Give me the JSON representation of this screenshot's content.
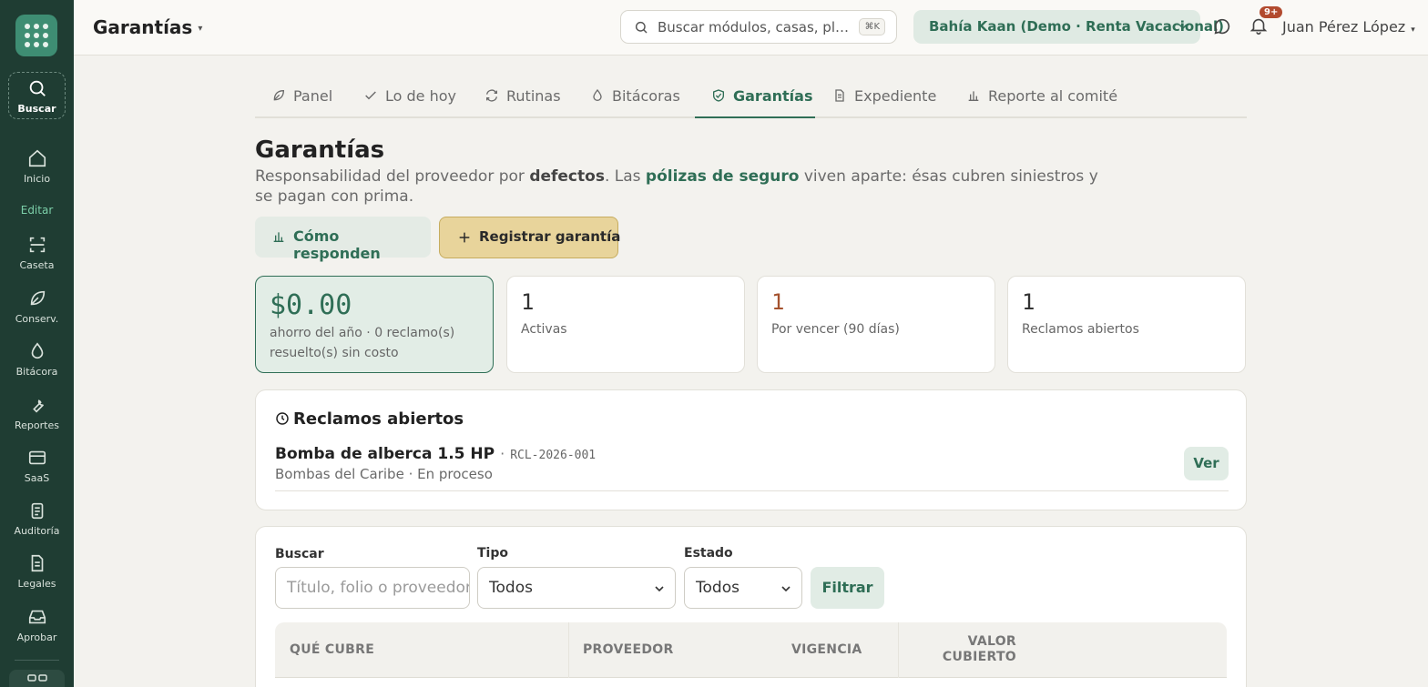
{
  "sidebar": {
    "items": [
      {
        "label": "Buscar",
        "icon": "search-icon"
      },
      {
        "label": "Inicio",
        "icon": "home-icon"
      },
      {
        "label": "Caseta",
        "icon": "scan-icon"
      },
      {
        "label": "Conserv.",
        "icon": "leaf-icon"
      },
      {
        "label": "Bitácora",
        "icon": "drop-icon"
      },
      {
        "label": "Reportes",
        "icon": "wrench-icon"
      },
      {
        "label": "SaaS",
        "icon": "card-icon"
      },
      {
        "label": "Auditoría",
        "icon": "clipboard-icon"
      },
      {
        "label": "Legales",
        "icon": "document-icon"
      },
      {
        "label": "Aprobar",
        "icon": "inbox-icon"
      }
    ],
    "section_label": "Editar"
  },
  "topbar": {
    "title": "Garantías",
    "search_placeholder": "Buscar módulos, casas, placas…",
    "search_shortcut": "⌘K",
    "org": "Bahía Kaan (Demo · Renta Vacacional)",
    "notifications_badge": "9+",
    "user": "Juan Pérez López"
  },
  "tabs": [
    {
      "label": "Panel",
      "icon": "leaf-icon"
    },
    {
      "label": "Lo de hoy",
      "icon": "check-icon"
    },
    {
      "label": "Rutinas",
      "icon": "repeat-icon"
    },
    {
      "label": "Bitácoras",
      "icon": "drop-icon"
    },
    {
      "label": "Garantías",
      "icon": "shield-check-icon",
      "active": true
    },
    {
      "label": "Expediente",
      "icon": "document-icon"
    },
    {
      "label": "Reporte al comité",
      "icon": "bar-chart-icon"
    }
  ],
  "page": {
    "title": "Garantías",
    "subtitle_pre": "Responsabilidad del proveedor por ",
    "subtitle_b1": "defectos",
    "subtitle_mid": ". Las ",
    "subtitle_b2": "pólizas de seguro",
    "subtitle_post": " viven aparte: ésas cubren siniestros y se pagan con prima.",
    "btn_how": "Cómo responden",
    "btn_register": "Registrar garantía"
  },
  "kpis": [
    {
      "value": "$0.00",
      "label": "ahorro del año · 0 reclamo(s) resuelto(s) sin costo"
    },
    {
      "value": "1",
      "label": "Activas"
    },
    {
      "value": "1",
      "label": "Por vencer (90 días)"
    },
    {
      "value": "1",
      "label": "Reclamos abiertos"
    }
  ],
  "claims": {
    "title": "Reclamos abiertos",
    "rows": [
      {
        "name": "Bomba de alberca 1.5 HP",
        "sep": "·",
        "folio": "RCL-2026-001",
        "detail": "Bombas del Caribe · En proceso",
        "action": "Ver"
      }
    ]
  },
  "filters": {
    "search_label": "Buscar",
    "search_placeholder": "Título, folio o proveedor",
    "type_label": "Tipo",
    "type_value": "Todos",
    "status_label": "Estado",
    "status_value": "Todos",
    "filter_button": "Filtrar"
  },
  "table": {
    "headers": [
      "QUÉ CUBRE",
      "PROVEEDOR",
      "VIGENCIA",
      "VALOR",
      "CUBIERTO"
    ]
  },
  "colors": {
    "sidebar_bg": "#1f3d33",
    "accent_green": "#2f6e56",
    "register_button": "#e8d49b",
    "warning": "#a4522e"
  }
}
